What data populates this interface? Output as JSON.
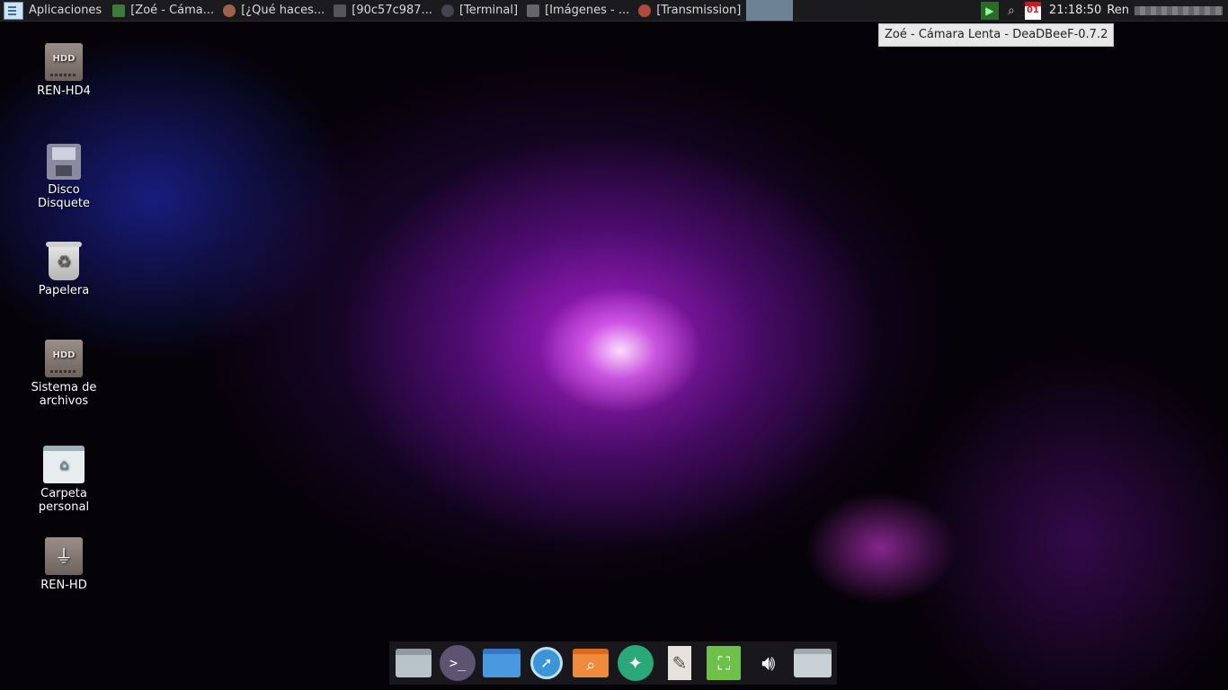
{
  "top_panel": {
    "apps_label": "Aplicaciones",
    "tasks": [
      {
        "label": "[Zoé - Cáma...",
        "icon": "deadbeef-play-icon",
        "color": "#3a7a3a"
      },
      {
        "label": "[¿Qué haces...",
        "icon": "browser-icon",
        "color": "#a0624a"
      },
      {
        "label": "[90c57c987...",
        "icon": "image-viewer-icon",
        "color": "#555555"
      },
      {
        "label": "[Terminal]",
        "icon": "terminal-icon",
        "color": "#444450"
      },
      {
        "label": "[Imágenes - ...",
        "icon": "file-manager-icon",
        "color": "#666666"
      },
      {
        "label": "[Transmission]",
        "icon": "transmission-icon",
        "color": "#b04a3a"
      }
    ],
    "clock": "21:18:50",
    "calendar_day": "01",
    "user": "Ren"
  },
  "tooltip": "Zoé - Cámara Lenta - DeaDBeeF-0.7.2",
  "desktop_icons": [
    {
      "label": "REN-HD4",
      "icon": "hdd-icon"
    },
    {
      "label": "Disco\nDisquete",
      "icon": "floppy-icon"
    },
    {
      "label": "Papelera",
      "icon": "trash-icon"
    },
    {
      "label": "Sistema de\narchivos",
      "icon": "hdd-icon"
    },
    {
      "label": "Carpeta\npersonal",
      "icon": "home-folder-icon"
    },
    {
      "label": "REN-HD",
      "icon": "usb-drive-icon"
    }
  ],
  "dock": [
    {
      "name": "drive-dock-icon"
    },
    {
      "name": "terminal-dock-icon",
      "glyph": ">_"
    },
    {
      "name": "folder-dock-icon"
    },
    {
      "name": "web-browser-dock-icon"
    },
    {
      "name": "search-dock-icon"
    },
    {
      "name": "games-dock-icon"
    },
    {
      "name": "text-editor-dock-icon"
    },
    {
      "name": "screenshot-dock-icon"
    },
    {
      "name": "volume-dock-icon"
    },
    {
      "name": "folder2-dock-icon"
    }
  ],
  "colors": {
    "panel_bg": "#1b1b1d",
    "accent_magenta": "#d028f0",
    "accent_blue": "#2832dc"
  }
}
